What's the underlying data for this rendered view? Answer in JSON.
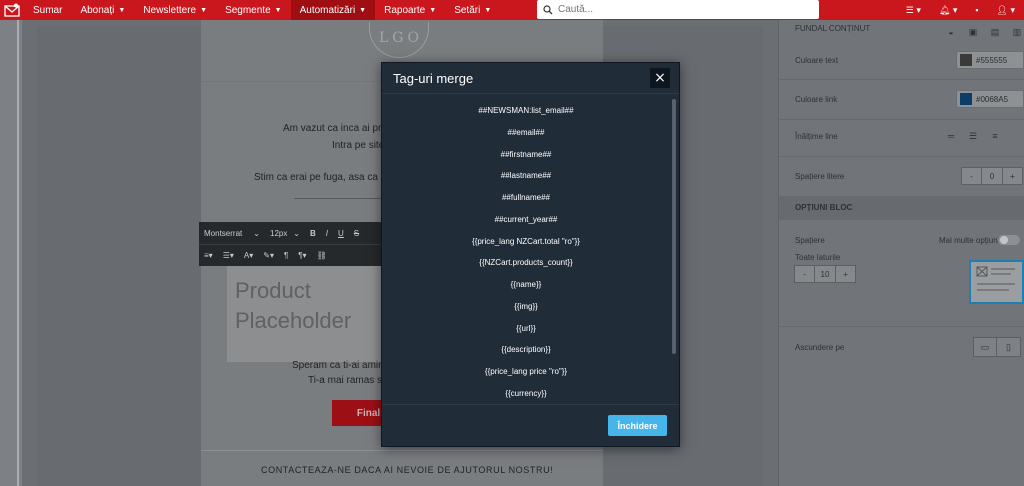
{
  "nav": {
    "items": [
      {
        "label": "Sumar",
        "caret": false
      },
      {
        "label": "Abonați",
        "caret": true
      },
      {
        "label": "Newslettere",
        "caret": true
      },
      {
        "label": "Segmente",
        "caret": true
      },
      {
        "label": "Automatizări",
        "caret": true,
        "active": true
      },
      {
        "label": "Rapoarte",
        "caret": true
      },
      {
        "label": "Setări",
        "caret": true
      }
    ],
    "search_placeholder": "Caută...",
    "colors": {
      "bar": "#c9171d",
      "active": "#9e0e13"
    }
  },
  "email": {
    "logo_letters": "LGO",
    "line1": "Am vazut ca inca ai pr",
    "line2": "Intra pe site",
    "line3": "Stim ca erai pe fuga, asa ca i",
    "placeholder_line1": "Product",
    "placeholder_line2": "Placeholder",
    "line4": "Speram ca ti-ai amin",
    "line5": "Ti-a mai ramas s",
    "button_label": "Finaliz",
    "footer_text": "CONTACTEAZA-NE DACA AI NEVOIE DE AJUTORUL NOSTRU!"
  },
  "toolbar": {
    "font": "Montserrat",
    "size": "12px",
    "bold": "B",
    "italic": "I",
    "underline": "U",
    "strike": "S"
  },
  "right_panel": {
    "cut_label": "FUNDAL CONȚINUT",
    "text_color_label": "Culoare text",
    "text_color_value": "#555555",
    "link_color_label": "Culoare link",
    "link_color_value": "#0068A5",
    "line_height_label": "Înălțime line",
    "letter_spacing_label": "Spațiere litere",
    "letter_spacing_value": "0",
    "block_options_label": "OPȚIUNI BLOC",
    "spacing_label": "Spațiere",
    "more_options_label": "Mai multe opțiuni",
    "all_sides_label": "Toate laturile",
    "all_sides_value": "10",
    "hide_on_label": "Ascundere pe"
  },
  "modal": {
    "title": "Tag-uri merge",
    "close_icon": "×",
    "tags": [
      "##NEWSMAN:list_email##",
      "##email##",
      "##firstname##",
      "##lastname##",
      "##fullname##",
      "##current_year##",
      "{{price_lang NZCart.total \"ro\"}}",
      "{{NZCart.products_count}}",
      "{{name}}",
      "{{img}}",
      "{{url}}",
      "{{description}}",
      "{{price_lang price \"ro\"}}",
      "{{currency}}"
    ],
    "close_button": "Închidere",
    "colors": {
      "bg": "#212c39",
      "button": "#46b5ea"
    }
  }
}
